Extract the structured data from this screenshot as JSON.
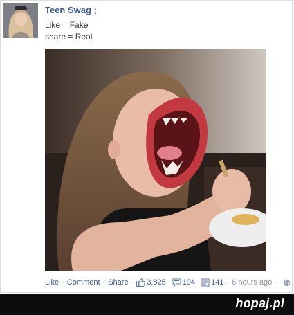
{
  "post": {
    "author": "Teen Swag ;",
    "line1": "Like = Fake",
    "line2": "share = Real"
  },
  "actions": {
    "like": "Like",
    "comment": "Comment",
    "share": "Share",
    "separator": "·",
    "likes_count": "3,825",
    "comments_count": "194",
    "shares_count": "141",
    "timestamp": "6 hours ago"
  },
  "footer": {
    "brand": "hopaj.pl"
  },
  "icons": {
    "likes": "thumbs-up-icon",
    "comments": "comment-bubble-icon",
    "shares": "share-doc-icon",
    "privacy": "globe-icon"
  },
  "colors": {
    "link": "#3b5998",
    "meta": "#8a8f98",
    "footer_bg": "#0d0d0d"
  }
}
